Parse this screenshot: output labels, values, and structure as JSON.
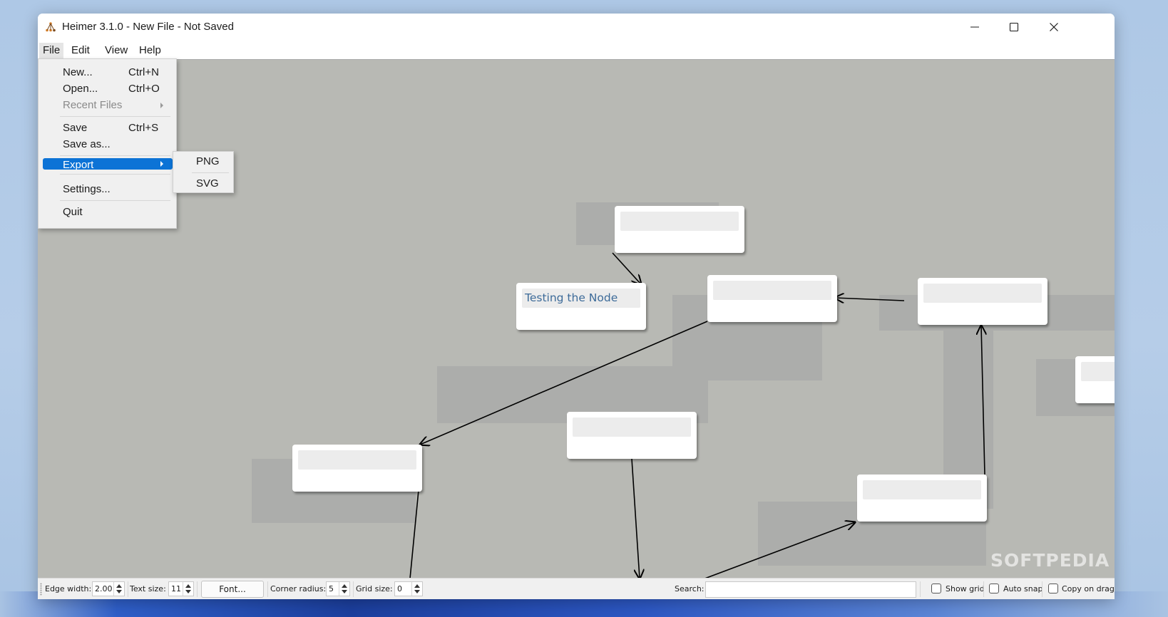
{
  "window": {
    "title": "Heimer 3.1.0 - New File - Not Saved"
  },
  "menubar": {
    "items": [
      {
        "label": "File"
      },
      {
        "label": "Edit"
      },
      {
        "label": "View"
      },
      {
        "label": "Help"
      }
    ]
  },
  "file_menu": {
    "new": {
      "label": "New...",
      "shortcut": "Ctrl+N"
    },
    "open": {
      "label": "Open...",
      "shortcut": "Ctrl+O"
    },
    "recent": {
      "label": "Recent Files"
    },
    "save": {
      "label": "Save",
      "shortcut": "Ctrl+S"
    },
    "save_as": {
      "label": "Save as..."
    },
    "export": {
      "label": "Export"
    },
    "settings": {
      "label": "Settings..."
    },
    "quit": {
      "label": "Quit"
    }
  },
  "export_menu": {
    "items": [
      {
        "label": "PNG"
      },
      {
        "label": "SVG"
      }
    ]
  },
  "canvas": {
    "node_text": "Testing the Node"
  },
  "toolbar": {
    "edge_width_label": "Edge width:",
    "edge_width_value": "2.00",
    "text_size_label": "Text size:",
    "text_size_value": "11",
    "font_button": "Font...",
    "corner_radius_label": "Corner radius:",
    "corner_radius_value": "5",
    "grid_size_label": "Grid size:",
    "grid_size_value": "0",
    "search_label": "Search:",
    "search_value": "",
    "show_grid_label": "Show grid",
    "auto_snap_label": "Auto snap",
    "copy_on_drag_label": "Copy on drag"
  },
  "watermark": "SOFTPEDIA",
  "colors": {
    "canvas_bg": "#b8b9b4",
    "highlight": "#0c73d6",
    "node_text": "#3d6b99"
  }
}
